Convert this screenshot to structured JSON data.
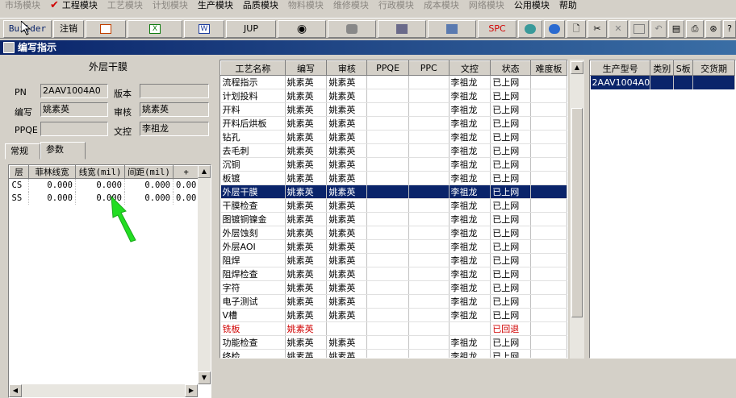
{
  "menu": {
    "items": [
      {
        "label": "市场模块",
        "active": false
      },
      {
        "label": "工程模块",
        "active": true,
        "checked": true
      },
      {
        "label": "工艺模块",
        "active": false
      },
      {
        "label": "计划模块",
        "active": false
      },
      {
        "label": "生产模块",
        "active": true
      },
      {
        "label": "品质模块",
        "active": true
      },
      {
        "label": "物料模块",
        "active": false
      },
      {
        "label": "维修模块",
        "active": false
      },
      {
        "label": "行政模块",
        "active": false
      },
      {
        "label": "成本模块",
        "active": false
      },
      {
        "label": "网络模块",
        "active": false
      },
      {
        "label": "公用模块",
        "active": true
      },
      {
        "label": "帮助",
        "active": true
      }
    ]
  },
  "toolbar": {
    "builder_label": "Builder",
    "logout_label": "注销",
    "jup_label": "JUP",
    "spc_label": "SPC",
    "icons": [
      "powerpoint-icon",
      "excel-icon",
      "word-icon",
      "eye-icon",
      "database-icon",
      "network-icon",
      "computer-icon",
      "globe-icon",
      "ie-icon",
      "new-document-icon",
      "cut-icon",
      "close-icon",
      "save-icon",
      "undo-icon",
      "print-preview-icon",
      "print-icon",
      "binoculars-icon",
      "help-icon"
    ]
  },
  "window": {
    "title": "编写指示"
  },
  "left": {
    "group_title": "外层干膜",
    "pn_label": "PN",
    "pn_value": "2AAV1004A0",
    "version_label": "版本",
    "version_value": "",
    "writer_label": "编写",
    "writer_value": "姚素英",
    "reviewer_label": "审核",
    "reviewer_value": "姚素英",
    "ppqe_label": "PPQE",
    "ppqe_value": "",
    "control_label": "文控",
    "control_value": "李祖龙",
    "tabs": [
      "常规",
      "参数"
    ],
    "param_headers": [
      "层",
      "菲林线宽",
      "线宽(mil)",
      "间距(mil)",
      "+"
    ],
    "param_rows": [
      [
        "CS",
        "0.000",
        "0.000",
        "0.000",
        "0.00"
      ],
      [
        "SS",
        "0.000",
        "0.000",
        "0.000",
        "0.00"
      ]
    ]
  },
  "main": {
    "headers": [
      "工艺名称",
      "编写",
      "审核",
      "PPQE",
      "PPC",
      "文控",
      "状态",
      "难度板"
    ],
    "rows": [
      [
        "流程指示",
        "姚素英",
        "姚素英",
        "",
        "",
        "李祖龙",
        "已上网",
        ""
      ],
      [
        "计划投料",
        "姚素英",
        "姚素英",
        "",
        "",
        "李祖龙",
        "已上网",
        ""
      ],
      [
        "开料",
        "姚素英",
        "姚素英",
        "",
        "",
        "李祖龙",
        "已上网",
        ""
      ],
      [
        "开料后烘板",
        "姚素英",
        "姚素英",
        "",
        "",
        "李祖龙",
        "已上网",
        ""
      ],
      [
        "钻孔",
        "姚素英",
        "姚素英",
        "",
        "",
        "李祖龙",
        "已上网",
        ""
      ],
      [
        "去毛刺",
        "姚素英",
        "姚素英",
        "",
        "",
        "李祖龙",
        "已上网",
        ""
      ],
      [
        "沉铜",
        "姚素英",
        "姚素英",
        "",
        "",
        "李祖龙",
        "已上网",
        ""
      ],
      [
        "板镀",
        "姚素英",
        "姚素英",
        "",
        "",
        "李祖龙",
        "已上网",
        ""
      ],
      [
        "外层干膜",
        "姚素英",
        "姚素英",
        "",
        "",
        "李祖龙",
        "已上网",
        ""
      ],
      [
        "干膜检查",
        "姚素英",
        "姚素英",
        "",
        "",
        "李祖龙",
        "已上网",
        ""
      ],
      [
        "图镀铜镍金",
        "姚素英",
        "姚素英",
        "",
        "",
        "李祖龙",
        "已上网",
        ""
      ],
      [
        "外层蚀刻",
        "姚素英",
        "姚素英",
        "",
        "",
        "李祖龙",
        "已上网",
        ""
      ],
      [
        "外层AOI",
        "姚素英",
        "姚素英",
        "",
        "",
        "李祖龙",
        "已上网",
        ""
      ],
      [
        "阻焊",
        "姚素英",
        "姚素英",
        "",
        "",
        "李祖龙",
        "已上网",
        ""
      ],
      [
        "阻焊检查",
        "姚素英",
        "姚素英",
        "",
        "",
        "李祖龙",
        "已上网",
        ""
      ],
      [
        "字符",
        "姚素英",
        "姚素英",
        "",
        "",
        "李祖龙",
        "已上网",
        ""
      ],
      [
        "电子测试",
        "姚素英",
        "姚素英",
        "",
        "",
        "李祖龙",
        "已上网",
        ""
      ],
      [
        "V槽",
        "姚素英",
        "姚素英",
        "",
        "",
        "李祖龙",
        "已上网",
        ""
      ],
      [
        "铣板",
        "姚素英",
        "",
        "",
        "",
        "",
        "已回退",
        ""
      ],
      [
        "功能检查",
        "姚素英",
        "姚素英",
        "",
        "",
        "李祖龙",
        "已上网",
        ""
      ],
      [
        "终检",
        "姚素英",
        "姚素英",
        "",
        "",
        "李祖龙",
        "已上网",
        ""
      ]
    ],
    "selected_index": 8,
    "rejected_index": 18
  },
  "right": {
    "headers": [
      "生产型号",
      "类别",
      "S板",
      "交货期"
    ],
    "rows": [
      [
        "2AAV1004A0",
        "",
        "",
        ""
      ]
    ]
  },
  "colors": {
    "selection": "#0a246a",
    "rejected": "#d00000",
    "annotation_arrow": "#22dd22"
  }
}
